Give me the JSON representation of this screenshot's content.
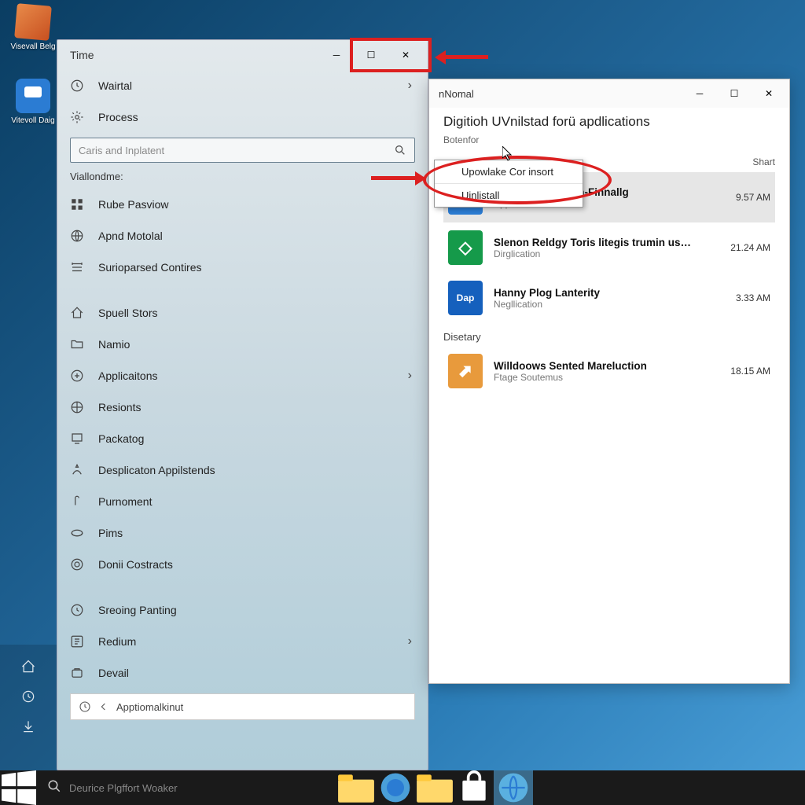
{
  "desktop": {
    "icons": [
      {
        "label": "Visevall Belg"
      },
      {
        "label": "Vitevoll Daig"
      }
    ]
  },
  "start_panel": {
    "title": "Time",
    "top_items": [
      {
        "label": "Wairtal",
        "has_chevron": true
      },
      {
        "label": "Process",
        "has_chevron": false
      }
    ],
    "search_placeholder": "Caris and Inplatent",
    "section_label": "Viallondme:",
    "menu_items": [
      {
        "label": "Rube Pasviow"
      },
      {
        "label": "Apnd Motolal"
      },
      {
        "label": "Surioparsed Contires"
      },
      {
        "label": "Spuell Stors"
      },
      {
        "label": "Namio"
      },
      {
        "label": "Applicaitons",
        "has_chevron": true
      },
      {
        "label": "Resionts"
      },
      {
        "label": "Packatog"
      },
      {
        "label": "Desplicaton Appilstends"
      },
      {
        "label": "Purnoment"
      },
      {
        "label": "Pims"
      },
      {
        "label": "Donii Costracts"
      },
      {
        "label": "Sreoing Panting"
      },
      {
        "label": "Redium",
        "has_chevron": true
      },
      {
        "label": "Devail"
      }
    ],
    "bottom_search": "Apptiomalkinut"
  },
  "right_window": {
    "titlebar": "nNomal",
    "header": "Digitioh UVnilstad forü apdlications",
    "subheader": "Botenfor",
    "col_shart": "Shart",
    "apps": [
      {
        "name": "Hanny Satry Tloth-Finnallg",
        "type": "Application",
        "time": "9.57 AM",
        "color": "#2b7cd3",
        "letter": "A",
        "selected": true
      },
      {
        "name": "Slenon Reldgy Toris litegis trumin us…",
        "type": "Dirglication",
        "time": "21.24 AM",
        "color": "#159a4a",
        "letter": "◇"
      },
      {
        "name": "Hanny Plog Lanterity",
        "type": "Negllication",
        "time": "3.33 AM",
        "color": "#1560bd",
        "letter": "Dap"
      }
    ],
    "section2": "Disetary",
    "apps2": [
      {
        "name": "Willdoows Sented Mareluction",
        "type": "Ftage Soutemus",
        "time": "18.15 AM",
        "color": "#e89a3c",
        "letter": "⬈"
      }
    ]
  },
  "context_menu": {
    "items": [
      "Upowlake Cor insort",
      "Uinlistall"
    ]
  },
  "taskbar": {
    "search_placeholder": "Deurice Plgffort Woaker"
  }
}
